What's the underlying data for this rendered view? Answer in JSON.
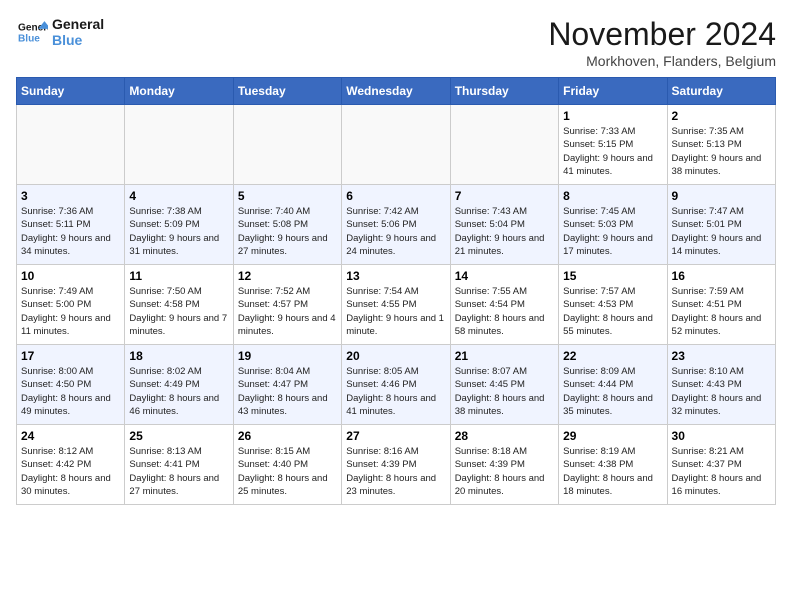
{
  "header": {
    "logo_line1": "General",
    "logo_line2": "Blue",
    "month_title": "November 2024",
    "location": "Morkhoven, Flanders, Belgium"
  },
  "weekdays": [
    "Sunday",
    "Monday",
    "Tuesday",
    "Wednesday",
    "Thursday",
    "Friday",
    "Saturday"
  ],
  "weeks": [
    [
      {
        "day": "",
        "info": ""
      },
      {
        "day": "",
        "info": ""
      },
      {
        "day": "",
        "info": ""
      },
      {
        "day": "",
        "info": ""
      },
      {
        "day": "",
        "info": ""
      },
      {
        "day": "1",
        "info": "Sunrise: 7:33 AM\nSunset: 5:15 PM\nDaylight: 9 hours and 41 minutes."
      },
      {
        "day": "2",
        "info": "Sunrise: 7:35 AM\nSunset: 5:13 PM\nDaylight: 9 hours and 38 minutes."
      }
    ],
    [
      {
        "day": "3",
        "info": "Sunrise: 7:36 AM\nSunset: 5:11 PM\nDaylight: 9 hours and 34 minutes."
      },
      {
        "day": "4",
        "info": "Sunrise: 7:38 AM\nSunset: 5:09 PM\nDaylight: 9 hours and 31 minutes."
      },
      {
        "day": "5",
        "info": "Sunrise: 7:40 AM\nSunset: 5:08 PM\nDaylight: 9 hours and 27 minutes."
      },
      {
        "day": "6",
        "info": "Sunrise: 7:42 AM\nSunset: 5:06 PM\nDaylight: 9 hours and 24 minutes."
      },
      {
        "day": "7",
        "info": "Sunrise: 7:43 AM\nSunset: 5:04 PM\nDaylight: 9 hours and 21 minutes."
      },
      {
        "day": "8",
        "info": "Sunrise: 7:45 AM\nSunset: 5:03 PM\nDaylight: 9 hours and 17 minutes."
      },
      {
        "day": "9",
        "info": "Sunrise: 7:47 AM\nSunset: 5:01 PM\nDaylight: 9 hours and 14 minutes."
      }
    ],
    [
      {
        "day": "10",
        "info": "Sunrise: 7:49 AM\nSunset: 5:00 PM\nDaylight: 9 hours and 11 minutes."
      },
      {
        "day": "11",
        "info": "Sunrise: 7:50 AM\nSunset: 4:58 PM\nDaylight: 9 hours and 7 minutes."
      },
      {
        "day": "12",
        "info": "Sunrise: 7:52 AM\nSunset: 4:57 PM\nDaylight: 9 hours and 4 minutes."
      },
      {
        "day": "13",
        "info": "Sunrise: 7:54 AM\nSunset: 4:55 PM\nDaylight: 9 hours and 1 minute."
      },
      {
        "day": "14",
        "info": "Sunrise: 7:55 AM\nSunset: 4:54 PM\nDaylight: 8 hours and 58 minutes."
      },
      {
        "day": "15",
        "info": "Sunrise: 7:57 AM\nSunset: 4:53 PM\nDaylight: 8 hours and 55 minutes."
      },
      {
        "day": "16",
        "info": "Sunrise: 7:59 AM\nSunset: 4:51 PM\nDaylight: 8 hours and 52 minutes."
      }
    ],
    [
      {
        "day": "17",
        "info": "Sunrise: 8:00 AM\nSunset: 4:50 PM\nDaylight: 8 hours and 49 minutes."
      },
      {
        "day": "18",
        "info": "Sunrise: 8:02 AM\nSunset: 4:49 PM\nDaylight: 8 hours and 46 minutes."
      },
      {
        "day": "19",
        "info": "Sunrise: 8:04 AM\nSunset: 4:47 PM\nDaylight: 8 hours and 43 minutes."
      },
      {
        "day": "20",
        "info": "Sunrise: 8:05 AM\nSunset: 4:46 PM\nDaylight: 8 hours and 41 minutes."
      },
      {
        "day": "21",
        "info": "Sunrise: 8:07 AM\nSunset: 4:45 PM\nDaylight: 8 hours and 38 minutes."
      },
      {
        "day": "22",
        "info": "Sunrise: 8:09 AM\nSunset: 4:44 PM\nDaylight: 8 hours and 35 minutes."
      },
      {
        "day": "23",
        "info": "Sunrise: 8:10 AM\nSunset: 4:43 PM\nDaylight: 8 hours and 32 minutes."
      }
    ],
    [
      {
        "day": "24",
        "info": "Sunrise: 8:12 AM\nSunset: 4:42 PM\nDaylight: 8 hours and 30 minutes."
      },
      {
        "day": "25",
        "info": "Sunrise: 8:13 AM\nSunset: 4:41 PM\nDaylight: 8 hours and 27 minutes."
      },
      {
        "day": "26",
        "info": "Sunrise: 8:15 AM\nSunset: 4:40 PM\nDaylight: 8 hours and 25 minutes."
      },
      {
        "day": "27",
        "info": "Sunrise: 8:16 AM\nSunset: 4:39 PM\nDaylight: 8 hours and 23 minutes."
      },
      {
        "day": "28",
        "info": "Sunrise: 8:18 AM\nSunset: 4:39 PM\nDaylight: 8 hours and 20 minutes."
      },
      {
        "day": "29",
        "info": "Sunrise: 8:19 AM\nSunset: 4:38 PM\nDaylight: 8 hours and 18 minutes."
      },
      {
        "day": "30",
        "info": "Sunrise: 8:21 AM\nSunset: 4:37 PM\nDaylight: 8 hours and 16 minutes."
      }
    ]
  ]
}
